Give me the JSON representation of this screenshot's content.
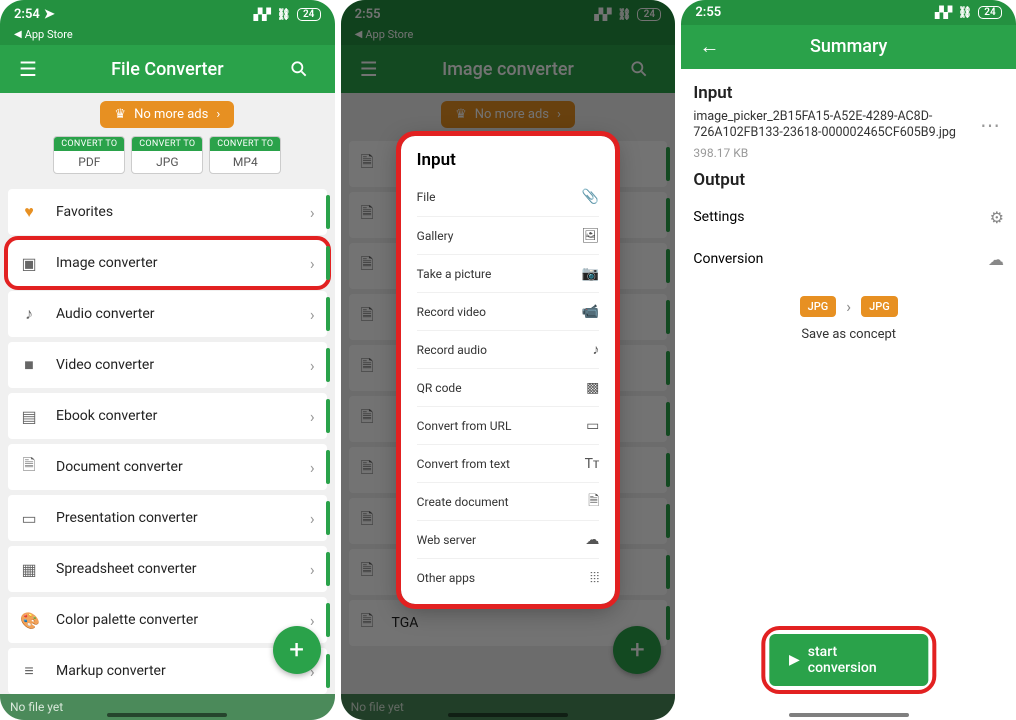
{
  "status": {
    "time_left": "2:54",
    "time_mid": "2:55",
    "time_right": "2:55",
    "back_label": "App Store",
    "signal_icon": "signal",
    "link_icon": "link",
    "battery": "24"
  },
  "left": {
    "title": "File Converter",
    "ad_label": "No more ads",
    "chips": [
      {
        "top": "CONVERT TO",
        "bot": "PDF"
      },
      {
        "top": "CONVERT TO",
        "bot": "JPG"
      },
      {
        "top": "CONVERT TO",
        "bot": "MP4"
      }
    ],
    "items": [
      {
        "icon": "heart",
        "label": "Favorites",
        "heart": true
      },
      {
        "icon": "image",
        "label": "Image converter",
        "highlight": true
      },
      {
        "icon": "music",
        "label": "Audio converter"
      },
      {
        "icon": "video",
        "label": "Video converter"
      },
      {
        "icon": "book",
        "label": "Ebook converter"
      },
      {
        "icon": "doc",
        "label": "Document converter"
      },
      {
        "icon": "screen",
        "label": "Presentation converter"
      },
      {
        "icon": "grid",
        "label": "Spreadsheet converter"
      },
      {
        "icon": "palette",
        "label": "Color palette converter"
      },
      {
        "icon": "lines",
        "label": "Markup converter"
      }
    ],
    "footer": "No file yet"
  },
  "mid": {
    "title": "Image converter",
    "ad_label": "No more ads",
    "modal_title": "Input",
    "options": [
      {
        "label": "File",
        "icon": "attach"
      },
      {
        "label": "Gallery",
        "icon": "image"
      },
      {
        "label": "Take a picture",
        "icon": "camera"
      },
      {
        "label": "Record video",
        "icon": "videocam"
      },
      {
        "label": "Record audio",
        "icon": "music"
      },
      {
        "label": "QR code",
        "icon": "qr"
      },
      {
        "label": "Convert from URL",
        "icon": "web"
      },
      {
        "label": "Convert from text",
        "icon": "text"
      },
      {
        "label": "Create document",
        "icon": "doc"
      },
      {
        "label": "Web server",
        "icon": "cloud"
      },
      {
        "label": "Other apps",
        "icon": "apps"
      }
    ],
    "bg_items": [
      "",
      "",
      "",
      "",
      "",
      "",
      "",
      "",
      "",
      "TGA"
    ],
    "footer": "No file yet"
  },
  "right": {
    "title": "Summary",
    "input_heading": "Input",
    "filename": "image_picker_2B15FA15-A52E-4289-AC8D-726A102FB133-23618-00000246​5CF605B9.jpg",
    "filesize": "398.17 KB",
    "output_heading": "Output",
    "settings_label": "Settings",
    "conversion_label": "Conversion",
    "from_fmt": "JPG",
    "to_fmt": "JPG",
    "save_concept": "Save as concept",
    "start_label": "start conversion"
  }
}
